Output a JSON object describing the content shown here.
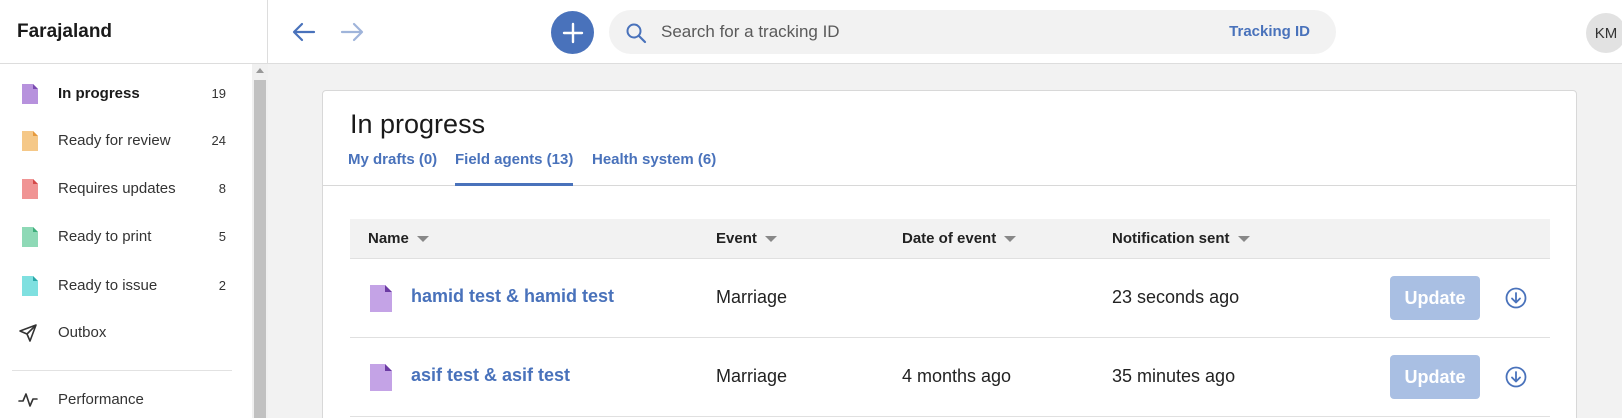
{
  "app": {
    "title": "Farajaland"
  },
  "sidebar": {
    "items": [
      {
        "label": "In progress",
        "count": "19",
        "color": "#b792dd"
      },
      {
        "label": "Ready for review",
        "count": "24",
        "color": "#f5c888"
      },
      {
        "label": "Requires updates",
        "count": "8",
        "color": "#f09494"
      },
      {
        "label": "Ready to print",
        "count": "5",
        "color": "#8ed9b6"
      },
      {
        "label": "Ready to issue",
        "count": "2",
        "color": "#7fe0e0"
      },
      {
        "label": "Outbox",
        "count": ""
      },
      {
        "label": "Performance",
        "count": ""
      }
    ]
  },
  "topbar": {
    "search_placeholder": "Search for a tracking ID",
    "search_type": "Tracking ID",
    "avatar_initials": "KM"
  },
  "main": {
    "title": "In progress",
    "tabs": [
      {
        "label": "My drafts (0)"
      },
      {
        "label": "Field agents (13)"
      },
      {
        "label": "Health system (6)"
      }
    ],
    "columns": [
      "Name",
      "Event",
      "Date of event",
      "Notification sent"
    ],
    "rows": [
      {
        "name": "hamid test & hamid test",
        "event": "Marriage",
        "date_of_event": "",
        "notification_sent": "23 seconds ago",
        "action": "Update"
      },
      {
        "name": "asif test & asif test",
        "event": "Marriage",
        "date_of_event": "4 months ago",
        "notification_sent": "35 minutes ago",
        "action": "Update"
      }
    ]
  },
  "colors": {
    "accent": "#4972bb",
    "update_button": "#a9bfe3"
  }
}
